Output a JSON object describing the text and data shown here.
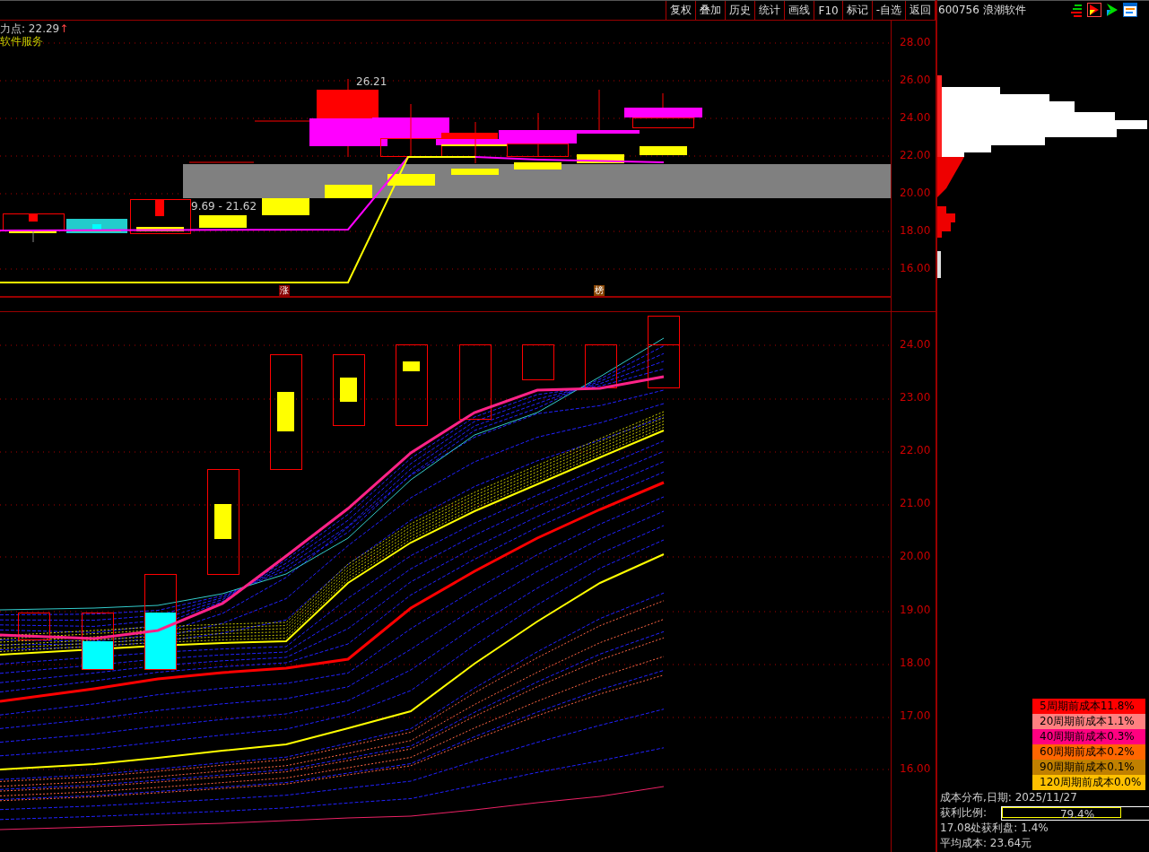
{
  "toolbar": {
    "buttons": [
      {
        "label": "复权"
      },
      {
        "label": "叠加"
      },
      {
        "label": "历史"
      },
      {
        "label": "统计"
      },
      {
        "label": "画线"
      },
      {
        "label": "F10"
      },
      {
        "label": "标记"
      },
      {
        "label": "-自选"
      },
      {
        "label": "返回"
      }
    ]
  },
  "stock": {
    "title": "600756 浪潮软件"
  },
  "upper_chart": {
    "pivot_label": "力点: 22.29",
    "pivot_arrow": "↑",
    "sector": "软件服务",
    "high_label": "26.21",
    "range_label": "9.69 - 21.62",
    "badges": [
      "涨",
      "榜"
    ],
    "axis": [
      "28.00",
      "26.00",
      "24.00",
      "22.00",
      "20.00",
      "18.00",
      "16.00"
    ]
  },
  "lower_chart": {
    "axis": [
      "24.00",
      "23.00",
      "22.00",
      "21.00",
      "20.00",
      "19.00",
      "18.00",
      "17.00",
      "16.00"
    ]
  },
  "cost_legend": [
    {
      "label": "5周期前成本11.8%",
      "color": "#ff0000"
    },
    {
      "label": "20周期前成本1.1%",
      "color": "#ff8080"
    },
    {
      "label": "40周期前成本0.3%",
      "color": "#ff0080"
    },
    {
      "label": "60周期前成本0.2%",
      "color": "#ff6600"
    },
    {
      "label": "90周期前成本0.1%",
      "color": "#c08000"
    },
    {
      "label": "120周期前成本0.0%",
      "color": "#ffc000"
    }
  ],
  "cost_info": {
    "date_line": "成本分布,日期: 2025/11/27",
    "profit_label": "获利比例:",
    "profit_value": "79.4%",
    "level": 0.794,
    "profit_at": "17.08处获利盘: 1.4%",
    "avg_cost": "平均成本: 23.64元"
  }
}
